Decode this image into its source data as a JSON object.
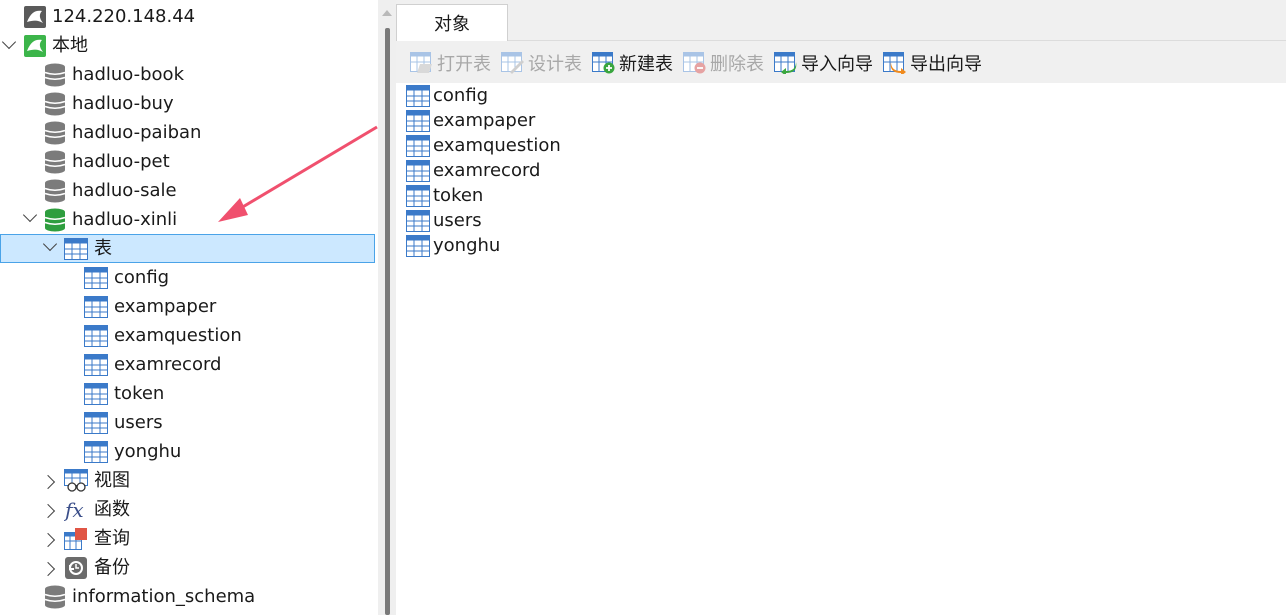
{
  "tree": {
    "server_remote": "124.220.148.44",
    "server_local": "本地",
    "databases": [
      "hadluo-book",
      "hadluo-buy",
      "hadluo-paiban",
      "hadluo-pet",
      "hadluo-sale"
    ],
    "open_database": "hadluo-xinli",
    "tables_node": "表",
    "tables": [
      "config",
      "exampaper",
      "examquestion",
      "examrecord",
      "token",
      "users",
      "yonghu"
    ],
    "views_node": "视图",
    "functions_node": "函数",
    "queries_node": "查询",
    "backups_node": "备份",
    "last_database": "information_schema"
  },
  "tab": {
    "label": "对象"
  },
  "toolbar": {
    "open_table": "打开表",
    "design_table": "设计表",
    "new_table": "新建表",
    "delete_table": "删除表",
    "import_wizard": "导入向导",
    "export_wizard": "导出向导"
  },
  "objects": [
    "config",
    "exampaper",
    "examquestion",
    "examrecord",
    "token",
    "users",
    "yonghu"
  ],
  "colors": {
    "selection_bg": "#cce8ff",
    "selection_border": "#4aa3e8",
    "arrow": "#f0506e",
    "db_gray": "#7b7b7b",
    "db_green": "#2e9e3e",
    "table_blue": "#3b7ac9"
  }
}
